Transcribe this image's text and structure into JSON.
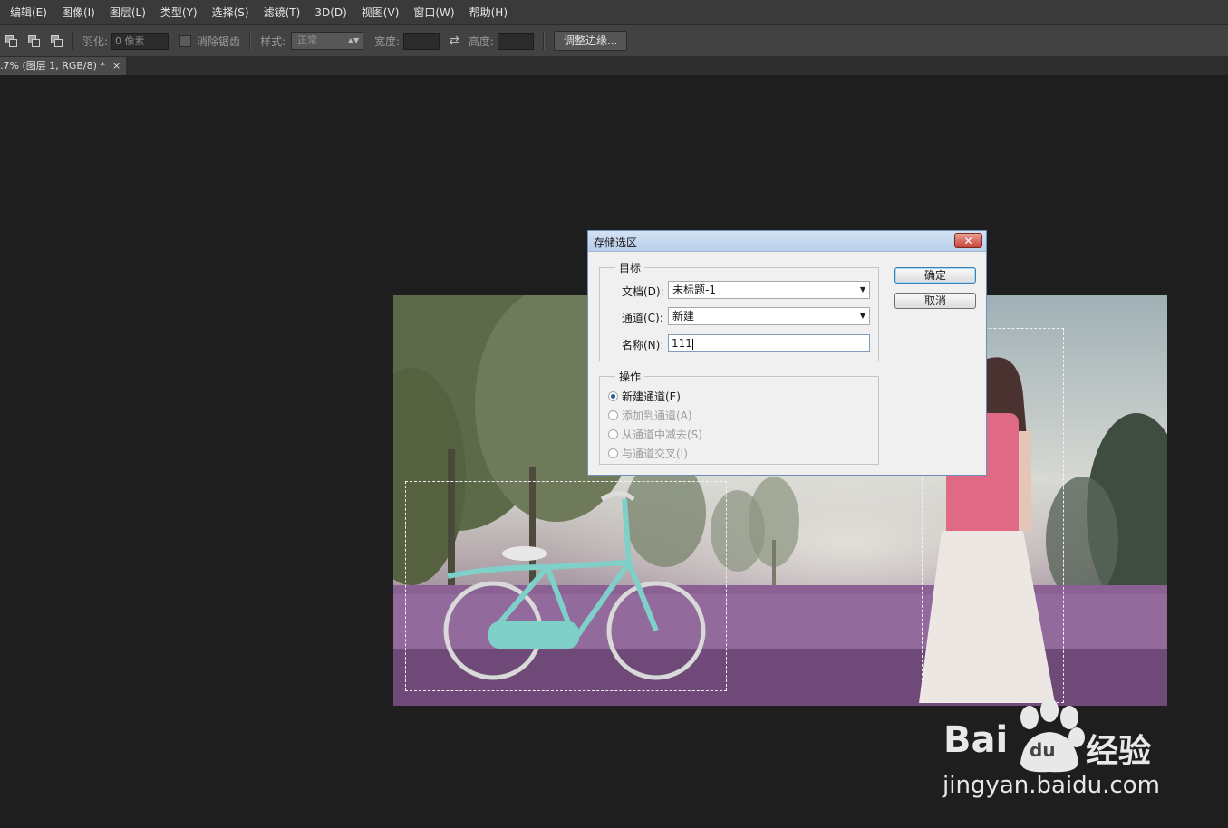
{
  "menubar": {
    "items": [
      "编辑(E)",
      "图像(I)",
      "图层(L)",
      "类型(Y)",
      "选择(S)",
      "滤镜(T)",
      "3D(D)",
      "视图(V)",
      "窗口(W)",
      "帮助(H)"
    ]
  },
  "options": {
    "feather_label": "羽化:",
    "feather_value": "0 像素",
    "antialias_label": "消除锯齿",
    "style_label": "样式:",
    "style_value": "正常",
    "width_label": "宽度:",
    "height_label": "高度:",
    "refine_edge_label": "调整边缘..."
  },
  "document_tab": {
    "label": ".7% (图层 1, RGB/8) *",
    "close": "×"
  },
  "dialog": {
    "title": "存储选区",
    "close": "✕",
    "target_group": "目标",
    "document_label": "文档(D):",
    "document_value": "未标题-1",
    "channel_label": "通道(C):",
    "channel_value": "新建",
    "name_label": "名称(N):",
    "name_value": "111",
    "operation_group": "操作",
    "operations": [
      {
        "label": "新建通道(E)",
        "selected": true,
        "enabled": true
      },
      {
        "label": "添加到通道(A)",
        "selected": false,
        "enabled": false
      },
      {
        "label": "从通道中减去(S)",
        "selected": false,
        "enabled": false
      },
      {
        "label": "与通道交叉(I)",
        "selected": false,
        "enabled": false
      }
    ],
    "ok_label": "确定",
    "cancel_label": "取消"
  },
  "watermark": {
    "brand_left": "Bai",
    "brand_du": "du",
    "brand_cn": "经验",
    "url": "jingyan.baidu.com"
  },
  "colors": {
    "annotation": "#e5262d",
    "app_bg": "#1e1e1e"
  }
}
